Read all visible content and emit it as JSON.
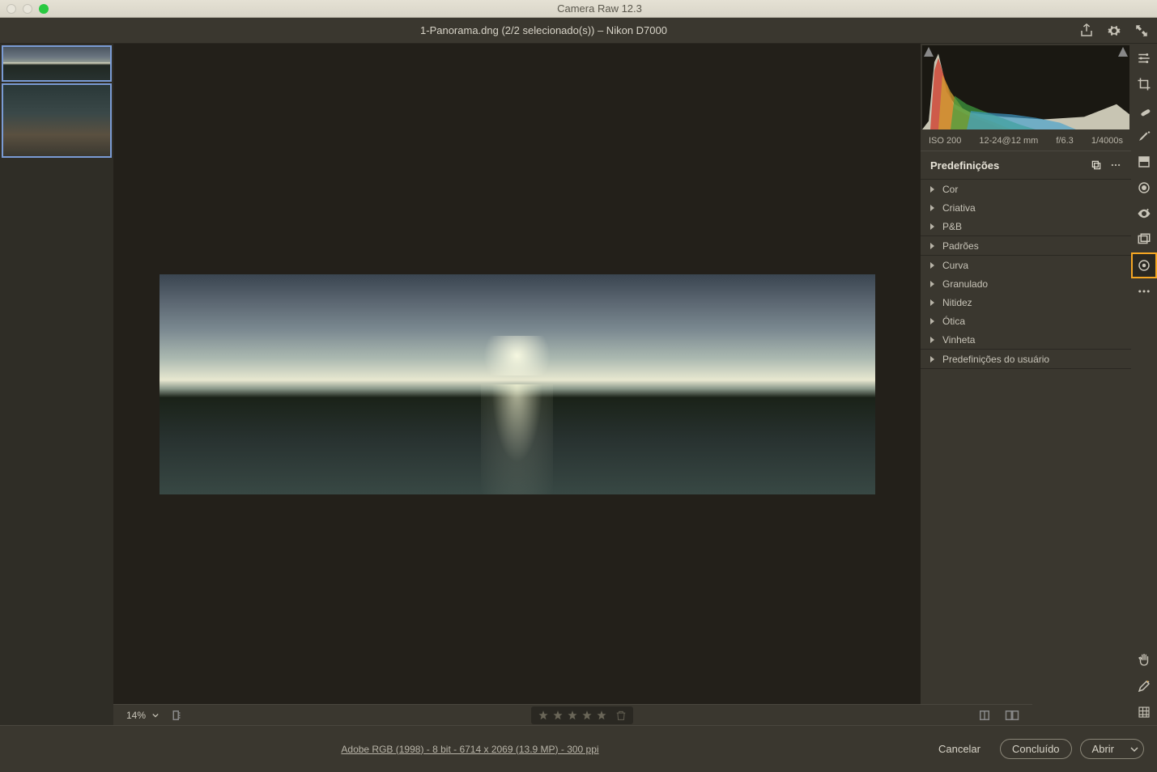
{
  "window": {
    "title": "Camera Raw 12.3"
  },
  "header": {
    "title": "1-Panorama.dng (2/2 selecionado(s))  –  Nikon D7000"
  },
  "exif": {
    "iso": "ISO 200",
    "lens": "12-24@12 mm",
    "aperture": "f/6.3",
    "shutter": "1/4000s"
  },
  "panel": {
    "title": "Predefinições"
  },
  "presets": {
    "group1": [
      "Cor",
      "Criativa",
      "P&B"
    ],
    "group2": [
      "Padrões"
    ],
    "group3": [
      "Curva",
      "Granulado",
      "Nitidez",
      "Ótica",
      "Vinheta"
    ],
    "group4": [
      "Predefinições do usuário"
    ]
  },
  "zoom": {
    "level": "14%"
  },
  "workflow": {
    "text": "Adobe RGB (1998) - 8 bit - 6714 x 2069 (13.9 MP) - 300 ppi"
  },
  "footer": {
    "cancel": "Cancelar",
    "done": "Concluído",
    "open": "Abrir"
  }
}
